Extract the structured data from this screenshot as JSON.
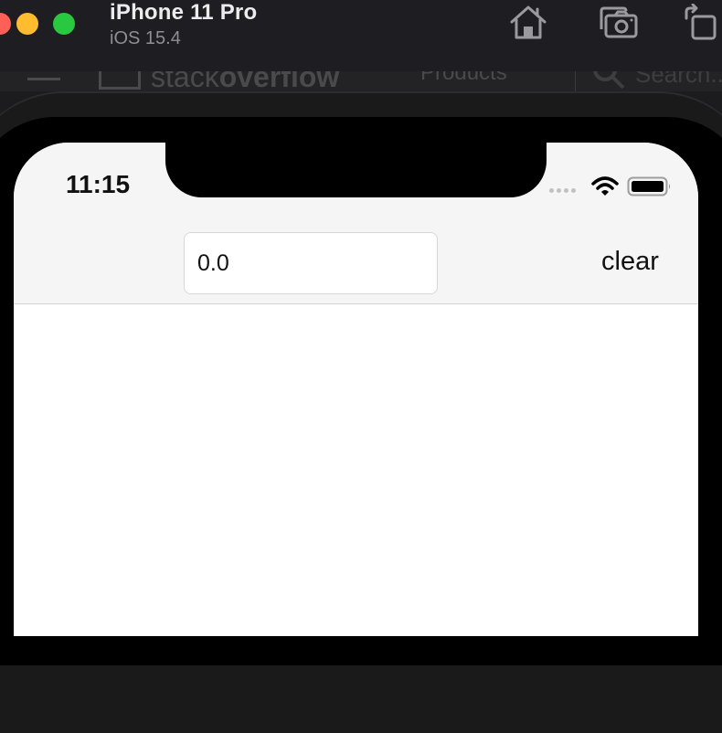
{
  "simulator": {
    "device_name": "iPhone 11 Pro",
    "os_version": "iOS 15.4",
    "toolbar_icons": [
      "home-icon",
      "screenshot-icon",
      "rotate-icon"
    ]
  },
  "background_page": {
    "logo_light": "stack",
    "logo_bold": "overflow",
    "nav_products": "Products",
    "search_placeholder": "Search..."
  },
  "status_bar": {
    "time": "11:15",
    "icons": [
      "cellular-signal-icon",
      "wifi-icon",
      "battery-icon"
    ]
  },
  "navbar": {
    "value_field": {
      "value": "0.0",
      "placeholder": ""
    },
    "clear_label": "clear"
  },
  "colors": {
    "titlebar_bg": "#1e1d21",
    "navbar_bg": "#f5f5f5",
    "traffic_red": "#fe5f57",
    "traffic_yellow": "#febc2e",
    "traffic_green": "#28c840"
  }
}
